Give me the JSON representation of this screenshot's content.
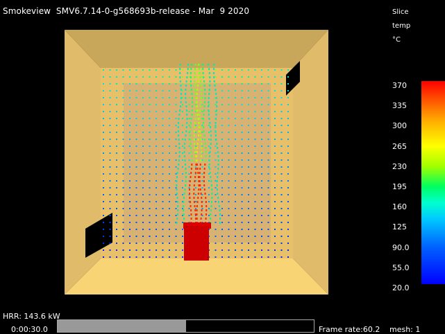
{
  "window": {
    "title": "Smokeview  SMV6.7.14-0-g568693b-release - Mar  9 2020"
  },
  "slice": {
    "line1": "Slice",
    "line2": "temp",
    "unit": "°C"
  },
  "colorbar": {
    "labels": [
      "370",
      "335",
      "300",
      "265",
      "230",
      "195",
      "160",
      "125",
      "90.0",
      "55.0",
      "20.0"
    ],
    "colors": [
      "#ff0000",
      "#ff5a00",
      "#ffb000",
      "#ffff00",
      "#a0ff00",
      "#00ff60",
      "#00ffd0",
      "#00c8ff",
      "#0060ff",
      "#0000ff"
    ]
  },
  "status": {
    "hrr": "HRR: 143.6 kW",
    "time": "0:00:30.0",
    "progress": 0.5,
    "frame_rate": "Frame rate:60.2",
    "mesh": "mesh: 1"
  },
  "scene": {
    "room_color": "#f5c860",
    "fire_color": "#cc0000"
  }
}
